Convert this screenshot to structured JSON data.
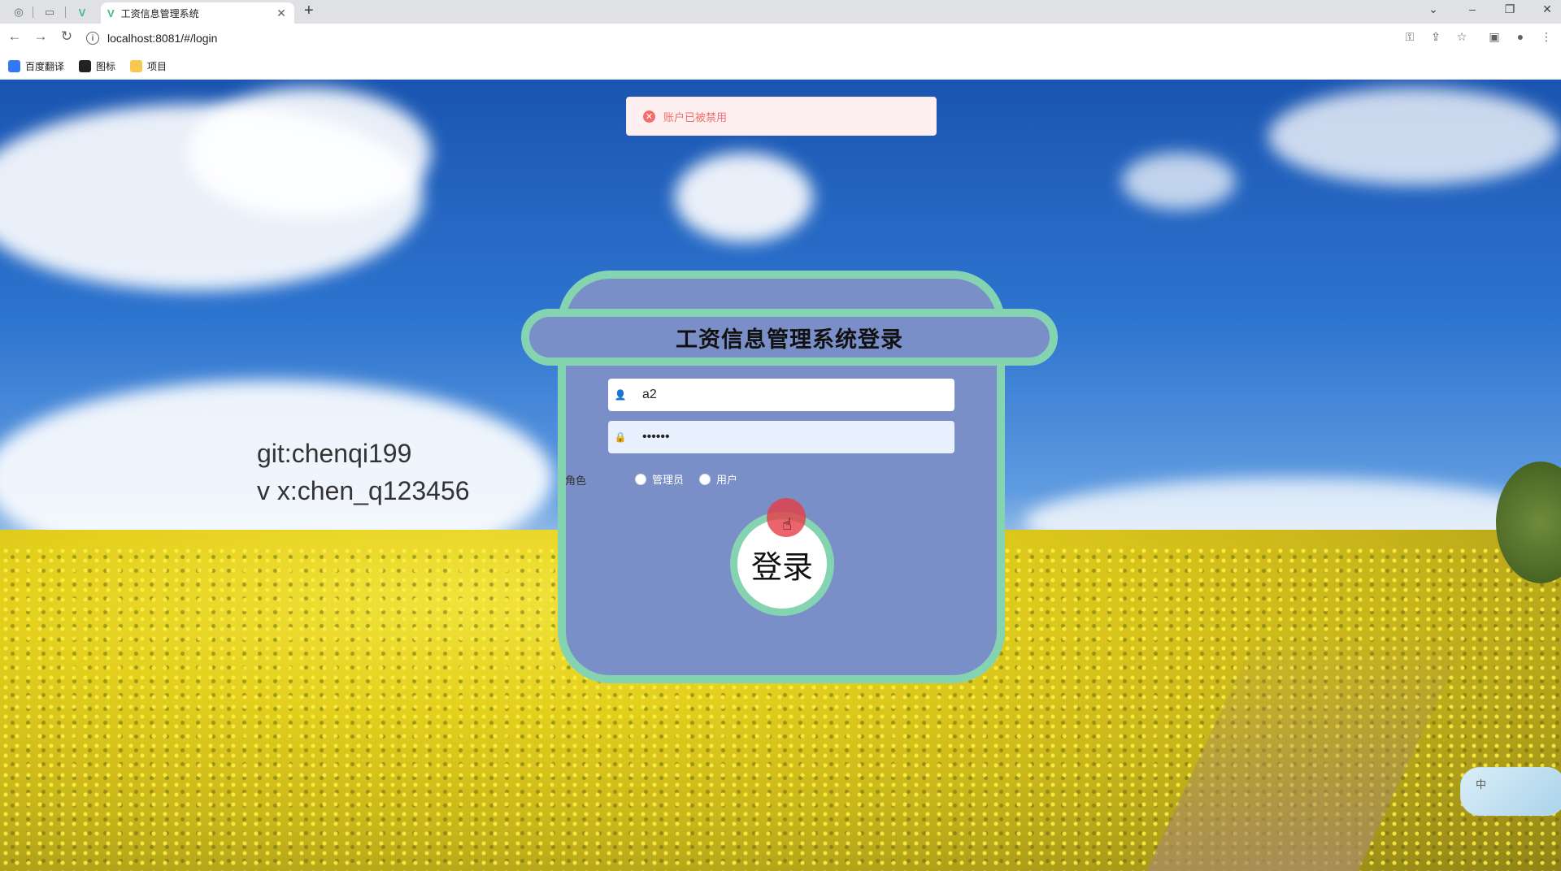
{
  "browser": {
    "active_tab_title": "工资信息管理系统",
    "url": "localhost:8081/#/login",
    "bookmarks": [
      {
        "label": "百度翻译"
      },
      {
        "label": "图标"
      },
      {
        "label": "项目"
      }
    ]
  },
  "toast": {
    "message": "账户已被禁用"
  },
  "watermark": {
    "line1": "git:chenqi199",
    "line2": "v x:chen_q123456"
  },
  "login": {
    "title": "工资信息管理系统登录",
    "username_value": "a2",
    "password_value": "••••••",
    "role_label": "角色",
    "role_options": [
      "管理员",
      "用户"
    ],
    "submit_label": "登录"
  },
  "ime": {
    "mode": "中"
  },
  "colors": {
    "card_bg": "#7a8fc8",
    "card_border": "#84d4b1",
    "toast_bg": "#fef0f0",
    "toast_text": "#f56c6c"
  }
}
